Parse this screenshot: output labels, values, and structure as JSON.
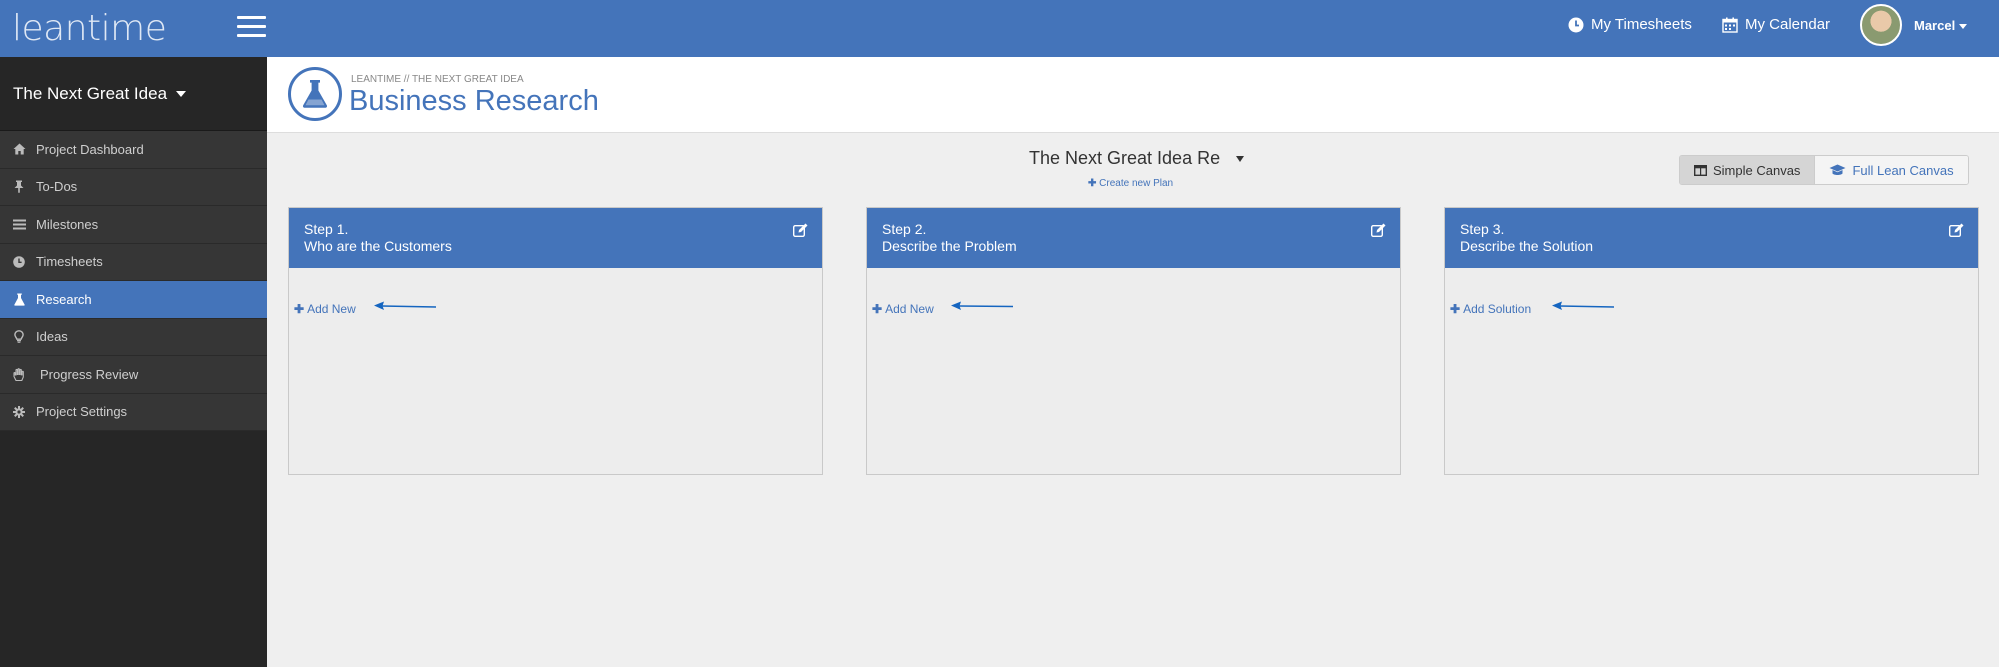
{
  "app": {
    "logo": "leantime"
  },
  "header": {
    "timesheets_label": "My Timesheets",
    "calendar_label": "My Calendar",
    "user_name": "Marcel"
  },
  "sidebar": {
    "project_name": "The Next Great Idea",
    "items": [
      {
        "label": "Project Dashboard",
        "icon": "home-icon"
      },
      {
        "label": "To-Dos",
        "icon": "pin-icon"
      },
      {
        "label": "Milestones",
        "icon": "sliders-icon"
      },
      {
        "label": "Timesheets",
        "icon": "clock-icon"
      },
      {
        "label": "Research",
        "icon": "flask-icon",
        "active": true
      },
      {
        "label": "Ideas",
        "icon": "lightbulb-icon"
      },
      {
        "label": "Progress Review",
        "icon": "hand-icon"
      },
      {
        "label": "Project Settings",
        "icon": "gear-icon"
      }
    ]
  },
  "page": {
    "breadcrumb": "LEANTIME // THE NEXT GREAT IDEA",
    "title": "Business Research",
    "icon": "flask-icon"
  },
  "plan": {
    "selected": "The Next Great Idea Re",
    "create_label": "Create new Plan"
  },
  "canvas_switch": {
    "simple_label": "Simple Canvas",
    "full_label": "Full Lean Canvas"
  },
  "columns": [
    {
      "step": "Step 1.",
      "title": "Who are the Customers",
      "add_label": "Add New"
    },
    {
      "step": "Step 2.",
      "title": "Describe the Problem",
      "add_label": "Add New"
    },
    {
      "step": "Step 3.",
      "title": "Describe the Solution",
      "add_label": "Add Solution"
    }
  ],
  "colors": {
    "brand": "#4474ba",
    "sidebar_bg": "#262626",
    "arrow": "#1565c0"
  }
}
